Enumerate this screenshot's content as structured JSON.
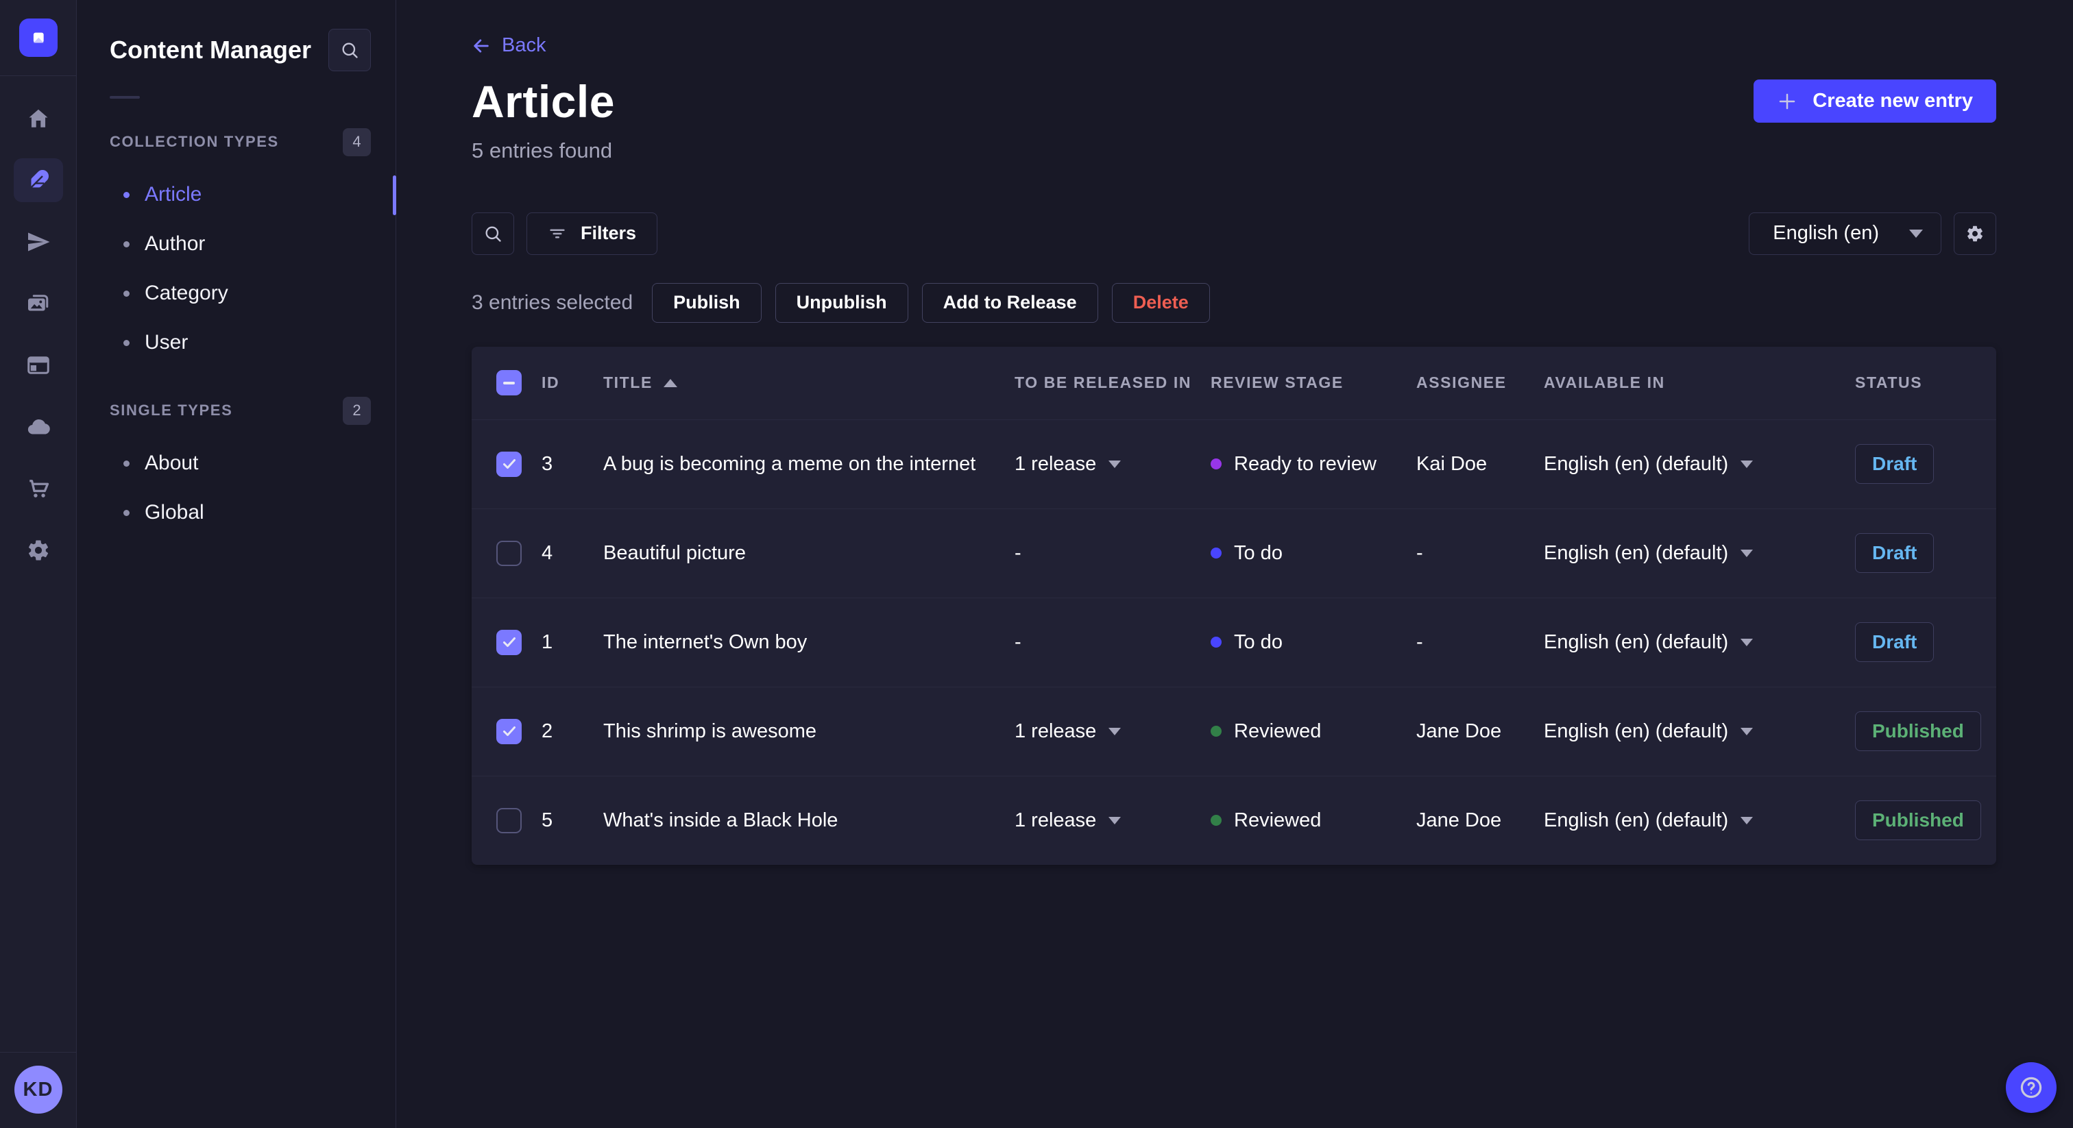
{
  "nav_rail": {
    "logo_name": "strapi-logo",
    "icons": [
      "home-icon",
      "feather-content-icon",
      "paper-plane-icon",
      "media-images-icon",
      "layout-builder-icon",
      "cloud-icon",
      "cart-marketplace-icon",
      "gear-settings-icon"
    ],
    "active_icon": "feather-content-icon",
    "avatar_initials": "KD"
  },
  "sidebar": {
    "title": "Content Manager",
    "search_icon": "search-icon",
    "sections": [
      {
        "label": "COLLECTION TYPES",
        "count": "4",
        "items": [
          {
            "label": "Article",
            "active": true
          },
          {
            "label": "Author",
            "active": false
          },
          {
            "label": "Category",
            "active": false
          },
          {
            "label": "User",
            "active": false
          }
        ]
      },
      {
        "label": "SINGLE TYPES",
        "count": "2",
        "items": [
          {
            "label": "About",
            "active": false
          },
          {
            "label": "Global",
            "active": false
          }
        ]
      }
    ]
  },
  "header": {
    "back_label": "Back",
    "title": "Article",
    "subtitle": "5 entries found",
    "create_button_label": "Create new entry"
  },
  "toolbar": {
    "filters_label": "Filters",
    "locale_value": "English (en)"
  },
  "selection": {
    "text": "3 entries selected",
    "publish_label": "Publish",
    "unpublish_label": "Unpublish",
    "add_to_release_label": "Add to Release",
    "delete_label": "Delete"
  },
  "table": {
    "headers": [
      "ID",
      "TITLE",
      "TO BE RELEASED IN",
      "REVIEW STAGE",
      "ASSIGNEE",
      "AVAILABLE IN",
      "STATUS"
    ],
    "sort_column": "TITLE",
    "sort_direction": "ascending",
    "rows": [
      {
        "selected": true,
        "id": "3",
        "title": "A bug is becoming a meme on the internet",
        "release": "1 release",
        "stage": "Ready to review",
        "stage_color": "#9736e8",
        "assignee": "Kai Doe",
        "locale": "English (en) (default)",
        "status": "Draft",
        "status_color": "#66b7f1"
      },
      {
        "selected": false,
        "id": "4",
        "title": "Beautiful picture",
        "release": "-",
        "stage": "To do",
        "stage_color": "#4945ff",
        "assignee": "-",
        "locale": "English (en) (default)",
        "status": "Draft",
        "status_color": "#66b7f1"
      },
      {
        "selected": true,
        "id": "1",
        "title": "The internet's Own boy",
        "release": "-",
        "stage": "To do",
        "stage_color": "#4945ff",
        "assignee": "-",
        "locale": "English (en) (default)",
        "status": "Draft",
        "status_color": "#66b7f1"
      },
      {
        "selected": true,
        "id": "2",
        "title": "This shrimp is awesome",
        "release": "1 release",
        "stage": "Reviewed",
        "stage_color": "#328048",
        "assignee": "Jane Doe",
        "locale": "English (en) (default)",
        "status": "Published",
        "status_color": "#5cb176"
      },
      {
        "selected": false,
        "id": "5",
        "title": "What's inside a Black Hole",
        "release": "1 release",
        "stage": "Reviewed",
        "stage_color": "#328048",
        "assignee": "Jane Doe",
        "locale": "English (en) (default)",
        "status": "Published",
        "status_color": "#5cb176"
      }
    ]
  },
  "colors": {
    "page_bg": "#181826",
    "panel_bg": "#212134",
    "border": "#32324d",
    "accent": "#4945ff",
    "accent_light": "#7b79ff",
    "text_muted": "#a5a5ba",
    "danger": "#ee5e52",
    "draft_text": "#66b7f1",
    "published_text": "#5cb176"
  }
}
